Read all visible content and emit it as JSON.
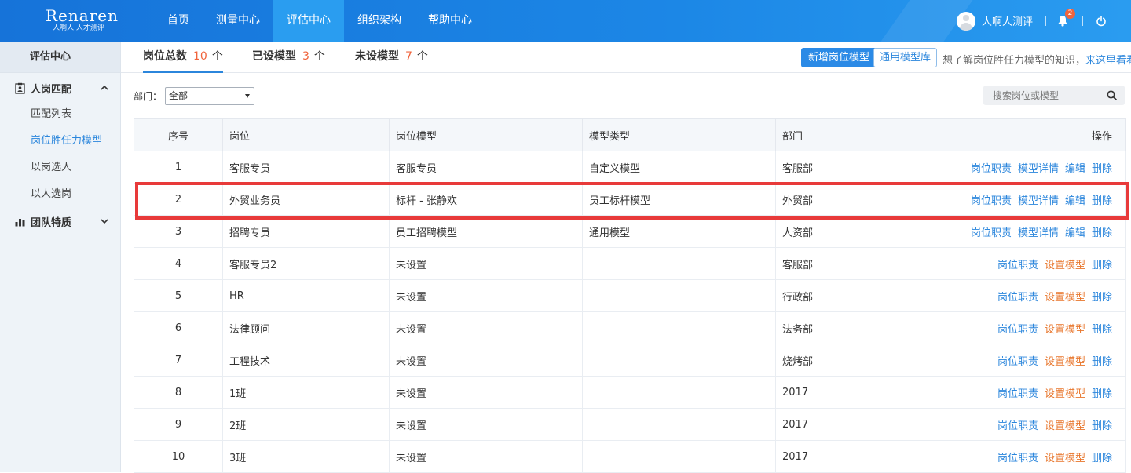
{
  "header": {
    "logo_main": "Renaren",
    "logo_sub": "人啊人·人才测评",
    "nav": [
      "首页",
      "测量中心",
      "评估中心",
      "组织架构",
      "帮助中心"
    ],
    "active_nav": "评估中心",
    "user_name": "人啊人测评",
    "notification_count": "2",
    "icons": {
      "avatar": "user-avatar-icon",
      "bell": "bell-icon",
      "power": "power-icon"
    },
    "colors": {
      "bar": "#1c87e6",
      "badge": "#f0643c"
    }
  },
  "sidebar": {
    "title": "评估中心",
    "groups": [
      {
        "label": "人岗匹配",
        "icon": "clipboard-user-icon",
        "expanded": true,
        "items": [
          "匹配列表",
          "岗位胜任力模型",
          "以岗选人",
          "以人选岗"
        ]
      },
      {
        "label": "团队特质",
        "icon": "bar-chart-icon",
        "expanded": false,
        "items": []
      }
    ],
    "active_item": "岗位胜任力模型"
  },
  "tabs": [
    {
      "label": "岗位总数",
      "count": "10",
      "unit": "个"
    },
    {
      "label": "已设模型",
      "count": "3",
      "unit": "个"
    },
    {
      "label": "未设模型",
      "count": "7",
      "unit": "个"
    }
  ],
  "toolbar": {
    "new_model_label": "新增岗位模型",
    "library_label": "通用模型库",
    "hint_text": "想了解岗位胜任力模型的知识，",
    "hint_link": "来这里看看"
  },
  "filter": {
    "label": "部门：",
    "value": "全部"
  },
  "search": {
    "placeholder": "搜索岗位或模型"
  },
  "table": {
    "headers": [
      "序号",
      "岗位",
      "岗位模型",
      "模型类型",
      "部门",
      "操作"
    ],
    "rows": [
      {
        "no": "1",
        "post": "客服专员",
        "model": "客服专员",
        "type": "自定义模型",
        "dept": "客服部",
        "ops": [
          "岗位职责",
          "模型详情",
          "编辑",
          "删除"
        ]
      },
      {
        "no": "2",
        "post": "外贸业务员",
        "model": "标杆 - 张静欢",
        "type": "员工标杆模型",
        "dept": "外贸部",
        "ops": [
          "岗位职责",
          "模型详情",
          "编辑",
          "删除"
        ]
      },
      {
        "no": "3",
        "post": "招聘专员",
        "model": "员工招聘模型",
        "type": "通用模型",
        "dept": "人资部",
        "ops": [
          "岗位职责",
          "模型详情",
          "编辑",
          "删除"
        ]
      },
      {
        "no": "4",
        "post": "客服专员2",
        "model": "未设置",
        "type": "",
        "dept": "客服部",
        "ops": [
          "岗位职责",
          "设置模型",
          "删除"
        ]
      },
      {
        "no": "5",
        "post": "HR",
        "model": "未设置",
        "type": "",
        "dept": "行政部",
        "ops": [
          "岗位职责",
          "设置模型",
          "删除"
        ]
      },
      {
        "no": "6",
        "post": "法律顾问",
        "model": "未设置",
        "type": "",
        "dept": "法务部",
        "ops": [
          "岗位职责",
          "设置模型",
          "删除"
        ]
      },
      {
        "no": "7",
        "post": "工程技术",
        "model": "未设置",
        "type": "",
        "dept": "烧烤部",
        "ops": [
          "岗位职责",
          "设置模型",
          "删除"
        ]
      },
      {
        "no": "8",
        "post": "1班",
        "model": "未设置",
        "type": "",
        "dept": "2017",
        "ops": [
          "岗位职责",
          "设置模型",
          "删除"
        ]
      },
      {
        "no": "9",
        "post": "2班",
        "model": "未设置",
        "type": "",
        "dept": "2017",
        "ops": [
          "岗位职责",
          "设置模型",
          "删除"
        ]
      },
      {
        "no": "10",
        "post": "3班",
        "model": "未设置",
        "type": "",
        "dept": "2017",
        "ops": [
          "岗位职责",
          "设置模型",
          "删除"
        ]
      }
    ],
    "highlighted_row": "2",
    "colors": {
      "link": "#2b86dc",
      "set_model": "#e8762c",
      "highlight": "#e83a3a"
    }
  }
}
